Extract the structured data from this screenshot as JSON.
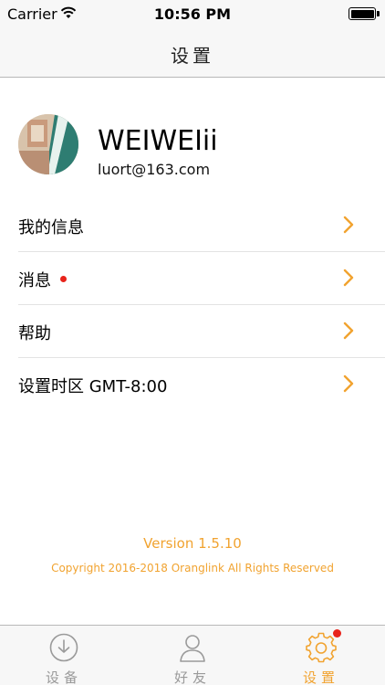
{
  "status_bar": {
    "carrier": "Carrier",
    "time": "10:56 PM"
  },
  "nav": {
    "title": "设置"
  },
  "profile": {
    "name": "WEIWEIii",
    "email": "luort@163.com"
  },
  "menu": {
    "items": [
      {
        "label": "我的信息",
        "has_dot": false
      },
      {
        "label": "消息",
        "has_dot": true
      },
      {
        "label": "帮助",
        "has_dot": false
      },
      {
        "label": "设置时区 GMT-8:00",
        "has_dot": false
      }
    ]
  },
  "footer": {
    "version": "Version 1.5.10",
    "copyright": "Copyright 2016-2018 Oranglink All Rights Reserved"
  },
  "tabs": [
    {
      "label": "设备",
      "icon": "device-icon",
      "active": false
    },
    {
      "label": "好友",
      "icon": "user-icon",
      "active": false
    },
    {
      "label": "设置",
      "icon": "gear-icon",
      "active": true,
      "badge": true
    }
  ],
  "colors": {
    "accent": "#f1a330",
    "badge": "#e8231b",
    "inactive": "#9a9a9a"
  }
}
